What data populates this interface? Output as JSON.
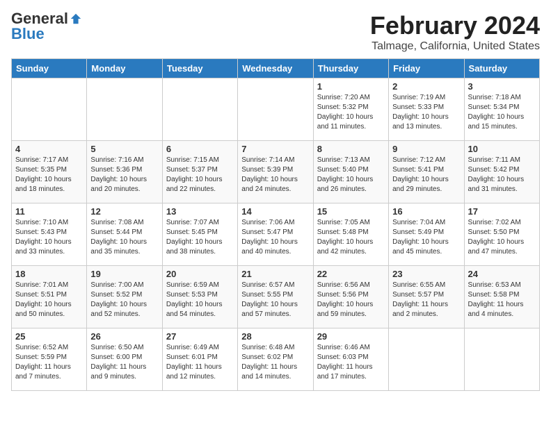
{
  "header": {
    "logo_general": "General",
    "logo_blue": "Blue",
    "title": "February 2024",
    "subtitle": "Talmage, California, United States"
  },
  "days_of_week": [
    "Sunday",
    "Monday",
    "Tuesday",
    "Wednesday",
    "Thursday",
    "Friday",
    "Saturday"
  ],
  "weeks": [
    [
      {
        "day": "",
        "info": ""
      },
      {
        "day": "",
        "info": ""
      },
      {
        "day": "",
        "info": ""
      },
      {
        "day": "",
        "info": ""
      },
      {
        "day": "1",
        "info": "Sunrise: 7:20 AM\nSunset: 5:32 PM\nDaylight: 10 hours\nand 11 minutes."
      },
      {
        "day": "2",
        "info": "Sunrise: 7:19 AM\nSunset: 5:33 PM\nDaylight: 10 hours\nand 13 minutes."
      },
      {
        "day": "3",
        "info": "Sunrise: 7:18 AM\nSunset: 5:34 PM\nDaylight: 10 hours\nand 15 minutes."
      }
    ],
    [
      {
        "day": "4",
        "info": "Sunrise: 7:17 AM\nSunset: 5:35 PM\nDaylight: 10 hours\nand 18 minutes."
      },
      {
        "day": "5",
        "info": "Sunrise: 7:16 AM\nSunset: 5:36 PM\nDaylight: 10 hours\nand 20 minutes."
      },
      {
        "day": "6",
        "info": "Sunrise: 7:15 AM\nSunset: 5:37 PM\nDaylight: 10 hours\nand 22 minutes."
      },
      {
        "day": "7",
        "info": "Sunrise: 7:14 AM\nSunset: 5:39 PM\nDaylight: 10 hours\nand 24 minutes."
      },
      {
        "day": "8",
        "info": "Sunrise: 7:13 AM\nSunset: 5:40 PM\nDaylight: 10 hours\nand 26 minutes."
      },
      {
        "day": "9",
        "info": "Sunrise: 7:12 AM\nSunset: 5:41 PM\nDaylight: 10 hours\nand 29 minutes."
      },
      {
        "day": "10",
        "info": "Sunrise: 7:11 AM\nSunset: 5:42 PM\nDaylight: 10 hours\nand 31 minutes."
      }
    ],
    [
      {
        "day": "11",
        "info": "Sunrise: 7:10 AM\nSunset: 5:43 PM\nDaylight: 10 hours\nand 33 minutes."
      },
      {
        "day": "12",
        "info": "Sunrise: 7:08 AM\nSunset: 5:44 PM\nDaylight: 10 hours\nand 35 minutes."
      },
      {
        "day": "13",
        "info": "Sunrise: 7:07 AM\nSunset: 5:45 PM\nDaylight: 10 hours\nand 38 minutes."
      },
      {
        "day": "14",
        "info": "Sunrise: 7:06 AM\nSunset: 5:47 PM\nDaylight: 10 hours\nand 40 minutes."
      },
      {
        "day": "15",
        "info": "Sunrise: 7:05 AM\nSunset: 5:48 PM\nDaylight: 10 hours\nand 42 minutes."
      },
      {
        "day": "16",
        "info": "Sunrise: 7:04 AM\nSunset: 5:49 PM\nDaylight: 10 hours\nand 45 minutes."
      },
      {
        "day": "17",
        "info": "Sunrise: 7:02 AM\nSunset: 5:50 PM\nDaylight: 10 hours\nand 47 minutes."
      }
    ],
    [
      {
        "day": "18",
        "info": "Sunrise: 7:01 AM\nSunset: 5:51 PM\nDaylight: 10 hours\nand 50 minutes."
      },
      {
        "day": "19",
        "info": "Sunrise: 7:00 AM\nSunset: 5:52 PM\nDaylight: 10 hours\nand 52 minutes."
      },
      {
        "day": "20",
        "info": "Sunrise: 6:59 AM\nSunset: 5:53 PM\nDaylight: 10 hours\nand 54 minutes."
      },
      {
        "day": "21",
        "info": "Sunrise: 6:57 AM\nSunset: 5:55 PM\nDaylight: 10 hours\nand 57 minutes."
      },
      {
        "day": "22",
        "info": "Sunrise: 6:56 AM\nSunset: 5:56 PM\nDaylight: 10 hours\nand 59 minutes."
      },
      {
        "day": "23",
        "info": "Sunrise: 6:55 AM\nSunset: 5:57 PM\nDaylight: 11 hours\nand 2 minutes."
      },
      {
        "day": "24",
        "info": "Sunrise: 6:53 AM\nSunset: 5:58 PM\nDaylight: 11 hours\nand 4 minutes."
      }
    ],
    [
      {
        "day": "25",
        "info": "Sunrise: 6:52 AM\nSunset: 5:59 PM\nDaylight: 11 hours\nand 7 minutes."
      },
      {
        "day": "26",
        "info": "Sunrise: 6:50 AM\nSunset: 6:00 PM\nDaylight: 11 hours\nand 9 minutes."
      },
      {
        "day": "27",
        "info": "Sunrise: 6:49 AM\nSunset: 6:01 PM\nDaylight: 11 hours\nand 12 minutes."
      },
      {
        "day": "28",
        "info": "Sunrise: 6:48 AM\nSunset: 6:02 PM\nDaylight: 11 hours\nand 14 minutes."
      },
      {
        "day": "29",
        "info": "Sunrise: 6:46 AM\nSunset: 6:03 PM\nDaylight: 11 hours\nand 17 minutes."
      },
      {
        "day": "",
        "info": ""
      },
      {
        "day": "",
        "info": ""
      }
    ]
  ]
}
